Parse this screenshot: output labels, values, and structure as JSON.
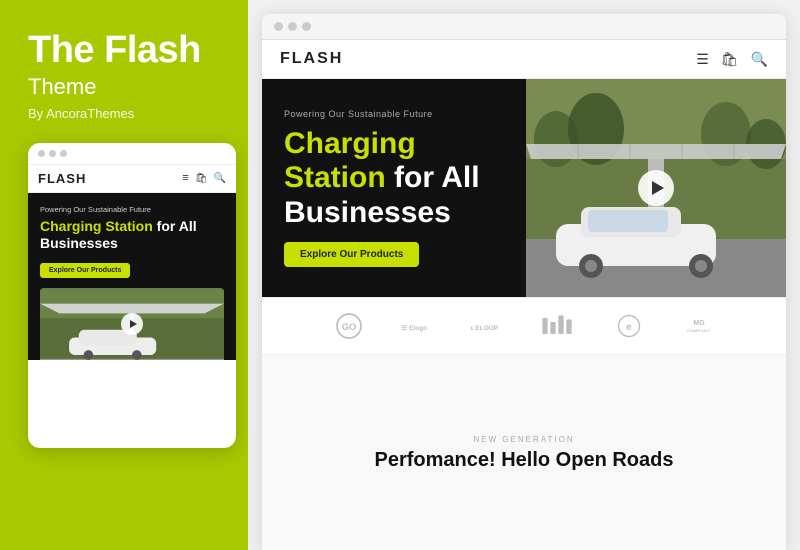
{
  "left": {
    "title": "The Flash",
    "subtitle": "Theme",
    "by_line": "By AncoraThemes",
    "mobile": {
      "dots": [
        "dot1",
        "dot2",
        "dot3"
      ],
      "logo": "FLASH",
      "hero_subtitle": "Powering Our Sustainable Future",
      "hero_title_yellow": "Charging Station",
      "hero_title_rest": "for All Businesses",
      "cta_btn": "Explore Our Products"
    }
  },
  "right": {
    "browser": {
      "dots": [
        "d1",
        "d2",
        "d3"
      ]
    },
    "site": {
      "logo": "FLASH",
      "nav_icon_menu": "≡",
      "nav_icon_bag": "🛍",
      "nav_icon_search": "🔍",
      "hero_subtitle": "Powering Our Sustainable Future",
      "hero_title_yellow": "Charging\nStation",
      "hero_title_white": " for All\nBusinesses",
      "cta_btn": "Explore Our Products"
    },
    "logos": [
      {
        "type": "svg",
        "id": "logo-go",
        "label": "GO"
      },
      {
        "type": "svg",
        "id": "logo-elogo",
        "label": "Elogo"
      },
      {
        "type": "svg",
        "id": "logo-eloop",
        "label": "ELOOP"
      },
      {
        "type": "svg",
        "id": "logo-bars",
        "label": ""
      },
      {
        "type": "svg",
        "id": "logo-e2",
        "label": ""
      },
      {
        "type": "text",
        "id": "logo-company",
        "line1": "MG",
        "line2": "COMPANY"
      }
    ],
    "bottom": {
      "new_gen": "NEW GENERATION",
      "heading": "Perfomance! Hello Open Roads"
    }
  }
}
